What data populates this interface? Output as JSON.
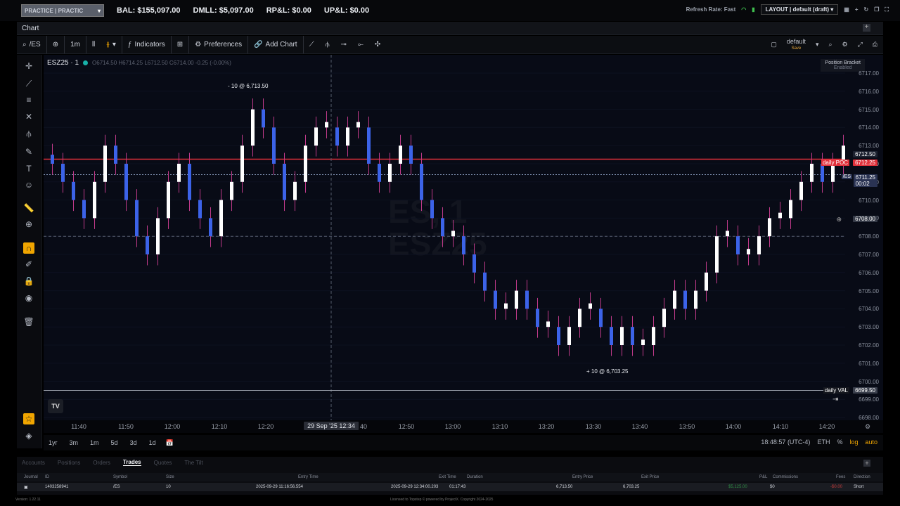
{
  "topbar": {
    "account_label": "PRACTICE | PRACTIC",
    "bal": "BAL: $155,097.00",
    "dmll": "DMLL: $5,097.00",
    "rpl": "RP&L: $0.00",
    "upl": "UP&L: $0.00",
    "refresh": "Refresh Rate: Fast",
    "layout": "LAYOUT | default (draft)"
  },
  "chart_tab": {
    "label": "Chart"
  },
  "toolbar": {
    "symbol": "/ES",
    "interval": "1m",
    "indicators": "Indicators",
    "preferences": "Preferences",
    "add_chart": "Add Chart",
    "template": "default",
    "template_sub": "Save"
  },
  "legend": {
    "symbol": "ESZ25 · 1",
    "ohlc": "O6714.50  H6714.25  L6712.50  C6714.00  -0.25 (-0.00%)"
  },
  "watermark": {
    "line1": "ES, 1",
    "line2": "ESZ25"
  },
  "position_bracket": {
    "title": "Position Bracket",
    "status": "Enabled"
  },
  "trade_labels": {
    "sell": "- 10 @ 6,713.50",
    "buy": "+ 10 @ 6,703.25"
  },
  "price_axis": {
    "ticks": [
      "6717.00",
      "6716.00",
      "6715.00",
      "6714.00",
      "6713.00",
      "6712.00",
      "6711.00",
      "6710.00",
      "6709.00",
      "6708.00",
      "6707.00",
      "6706.00",
      "6705.00",
      "6704.00",
      "6703.00",
      "6702.00",
      "6701.00",
      "6700.00",
      "6699.00",
      "6698.00"
    ],
    "current_price": "6712.50",
    "poc_price": "6712.25",
    "es_label": "/ES",
    "es_price": "6711.25",
    "es_timer": "00:02",
    "crosshair_price": "6708.00",
    "poc_label": "daily POC",
    "val_label": "daily VAL",
    "val_price": "6699.50"
  },
  "time_axis": {
    "ticks": [
      "11:40",
      "11:50",
      "12:00",
      "12:10",
      "12:20",
      "40",
      "12:50",
      "13:00",
      "13:10",
      "13:20",
      "13:30",
      "13:40",
      "13:50",
      "14:00",
      "14:10",
      "14:20"
    ],
    "cursor_label": "29 Sep '25  12:34"
  },
  "bottombar": {
    "ranges": [
      "1yr",
      "3m",
      "1m",
      "5d",
      "3d",
      "1d"
    ],
    "clock": "18:48:57 (UTC-4)",
    "session": "ETH",
    "percent": "%",
    "log": "log",
    "auto": "auto"
  },
  "panel": {
    "tabs": [
      "Accounts",
      "Positions",
      "Orders",
      "Trades",
      "Quotes",
      "The Tilt"
    ],
    "active_tab": "Trades",
    "headers": [
      "Journal",
      "ID",
      "Symbol",
      "Size",
      "Entry Time",
      "Exit Time",
      "Duration",
      "Entry Price",
      "Exit Price",
      "P&L",
      "Commissions",
      "Fees",
      "Direction"
    ],
    "row": {
      "id": "1403258941",
      "symbol": "/ES",
      "size": "10",
      "entry_time": "2025-09-29 11:16:56.554",
      "exit_time": "2025-09-29 12:34:00.203",
      "duration": "01:17:43",
      "entry_price": "6,713.50",
      "exit_price": "6,703.25",
      "pnl": "$5,125.00",
      "commissions": "$0",
      "fees": "-$0.00",
      "direction": "Short"
    }
  },
  "footer": {
    "version": "Version: 1.22.11",
    "license": "Licensed to Topstep © powered by ProjectX. Copyright 2024-2025"
  },
  "colors": {
    "up_candle": "#ffffff",
    "down_candle": "#3c63e8",
    "poc_line": "#e0303a",
    "accent": "#f0a500"
  },
  "chart_data": {
    "type": "candlestick",
    "ylim": [
      6698,
      6717
    ],
    "series": [
      {
        "name": "ESZ25",
        "values": [
          6712,
          6711,
          6710,
          6709,
          6711,
          6713,
          6712,
          6710,
          6708,
          6707,
          6709,
          6711,
          6712,
          6710,
          6709,
          6708,
          6710,
          6711,
          6713,
          6715,
          6714,
          6712,
          6710,
          6711,
          6713,
          6714,
          6714,
          6713,
          6714,
          6714,
          6712,
          6711,
          6712,
          6713,
          6712,
          6710,
          6709,
          6708,
          6708,
          6707,
          6706,
          6705,
          6704,
          6704,
          6705,
          6704,
          6703,
          6703,
          6702,
          6703,
          6704,
          6704,
          6703,
          6702,
          6703,
          6702,
          6702,
          6703,
          6704,
          6705,
          6704,
          6705,
          6706,
          6708,
          6708,
          6707,
          6707,
          6708,
          6709,
          6709,
          6710,
          6711,
          6712,
          6711,
          6712,
          6713
        ]
      }
    ]
  }
}
